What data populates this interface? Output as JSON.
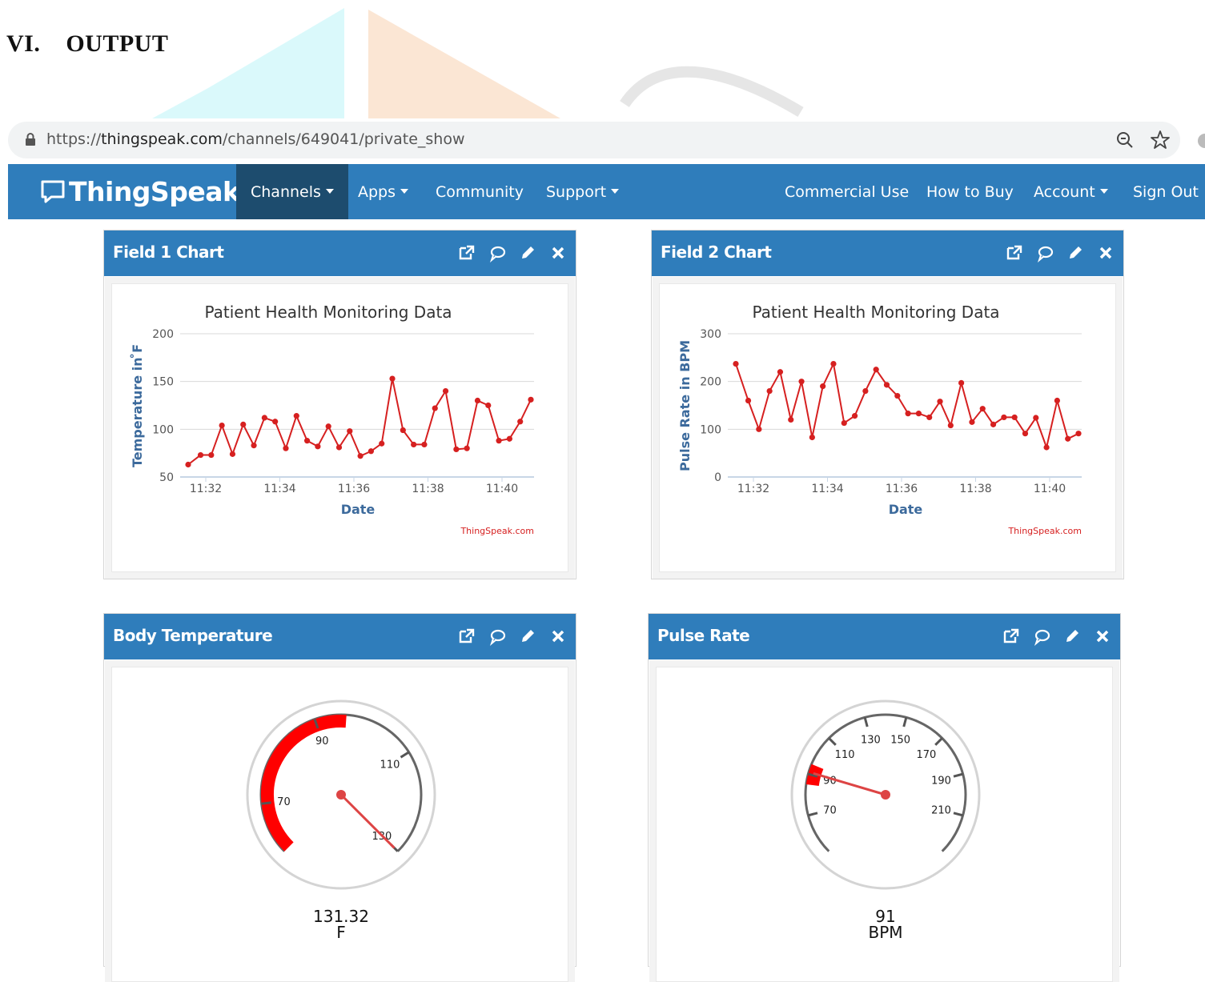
{
  "section_heading": "VI.    OUTPUT",
  "browser": {
    "url_scheme": "https://",
    "url_host": "thingspeak.com",
    "url_path": "/channels/649041/private_show"
  },
  "nav": {
    "brand": "ThingSpeak",
    "brand_tm": "™",
    "items": [
      {
        "label": "Channels",
        "dropdown": true,
        "active": true
      },
      {
        "label": "Apps",
        "dropdown": true
      },
      {
        "label": "Community"
      },
      {
        "label": "Support",
        "dropdown": true
      },
      {
        "label": "Commercial Use"
      },
      {
        "label": "How to Buy"
      },
      {
        "label": "Account",
        "dropdown": true
      },
      {
        "label": "Sign Out"
      }
    ]
  },
  "panels": {
    "field1": {
      "title": "Field 1 Chart"
    },
    "field2": {
      "title": "Field 2 Chart"
    },
    "temp": {
      "title": "Body Temperature"
    },
    "pulse": {
      "title": "Pulse Rate"
    }
  },
  "chart_data": [
    {
      "type": "line",
      "title": "Patient Health Monitoring Data",
      "xlabel": "Date",
      "ylabel": "Temperature in  ̊F",
      "credit": "ThingSpeak.com",
      "color": "#d62020",
      "ylim": [
        50,
        200
      ],
      "yticks": [
        50,
        100,
        150,
        200
      ],
      "xlim": [
        0,
        470
      ],
      "xticks": [
        {
          "label": "11:32",
          "t": 60
        },
        {
          "label": "11:34",
          "t": 180
        },
        {
          "label": "11:36",
          "t": 300
        },
        {
          "label": "11:38",
          "t": 420
        },
        {
          "label": "11:40",
          "t": 540
        }
      ],
      "series": [
        {
          "values": [
            [
              0,
              63
            ],
            [
              14,
              73
            ],
            [
              26,
              73
            ],
            [
              38,
              104
            ],
            [
              50,
              74
            ],
            [
              62,
              105
            ],
            [
              74,
              83
            ],
            [
              86,
              112
            ],
            [
              98,
              108
            ],
            [
              110,
              80
            ],
            [
              122,
              114
            ],
            [
              134,
              88
            ],
            [
              146,
              82
            ],
            [
              158,
              103
            ],
            [
              170,
              81
            ],
            [
              182,
              98
            ],
            [
              194,
              72
            ],
            [
              206,
              77
            ],
            [
              218,
              85
            ],
            [
              230,
              153
            ],
            [
              242,
              99
            ],
            [
              254,
              84
            ],
            [
              266,
              84
            ],
            [
              278,
              122
            ],
            [
              290,
              140
            ],
            [
              302,
              79
            ],
            [
              314,
              80
            ],
            [
              326,
              130
            ],
            [
              338,
              125
            ],
            [
              350,
              88
            ],
            [
              362,
              90
            ],
            [
              374,
              108
            ],
            [
              386,
              131
            ]
          ]
        }
      ]
    },
    {
      "type": "line",
      "title": "Patient Health Monitoring Data",
      "xlabel": "Date",
      "ylabel": "Pulse Rate in BPM",
      "credit": "ThingSpeak.com",
      "color": "#d62020",
      "ylim": [
        0,
        300
      ],
      "yticks": [
        0,
        100,
        200,
        300
      ],
      "xticks": [
        {
          "label": "11:32",
          "t": 60
        },
        {
          "label": "11:34",
          "t": 180
        },
        {
          "label": "11:36",
          "t": 300
        },
        {
          "label": "11:38",
          "t": 420
        },
        {
          "label": "11:40",
          "t": 540
        }
      ],
      "series": [
        {
          "values": [
            [
              0,
              237
            ],
            [
              14,
              160
            ],
            [
              26,
              100
            ],
            [
              38,
              180
            ],
            [
              50,
              220
            ],
            [
              62,
              120
            ],
            [
              74,
              200
            ],
            [
              86,
              83
            ],
            [
              98,
              190
            ],
            [
              110,
              237
            ],
            [
              122,
              113
            ],
            [
              134,
              128
            ],
            [
              146,
              180
            ],
            [
              158,
              225
            ],
            [
              170,
              193
            ],
            [
              182,
              170
            ],
            [
              194,
              133
            ],
            [
              206,
              133
            ],
            [
              218,
              125
            ],
            [
              230,
              158
            ],
            [
              242,
              108
            ],
            [
              254,
              197
            ],
            [
              266,
              115
            ],
            [
              278,
              143
            ],
            [
              290,
              110
            ],
            [
              302,
              125
            ],
            [
              314,
              125
            ],
            [
              326,
              91
            ],
            [
              338,
              124
            ],
            [
              350,
              62
            ],
            [
              362,
              160
            ],
            [
              374,
              80
            ],
            [
              386,
              91
            ]
          ]
        }
      ]
    }
  ],
  "gauges": {
    "temp": {
      "value": "131.32",
      "unit": "F",
      "numeric_value": 131.32,
      "min": 60,
      "max": 130,
      "ticks": [
        "70",
        "90",
        "110",
        "130"
      ],
      "red_range": [
        60,
        96
      ]
    },
    "pulse": {
      "value": "91",
      "unit": "BPM",
      "numeric_value": 91,
      "min": 50,
      "max": 230,
      "ticks": [
        "70",
        "90",
        "110",
        "130",
        "150",
        "170",
        "190",
        "210"
      ],
      "red_range": [
        85,
        95
      ]
    }
  }
}
